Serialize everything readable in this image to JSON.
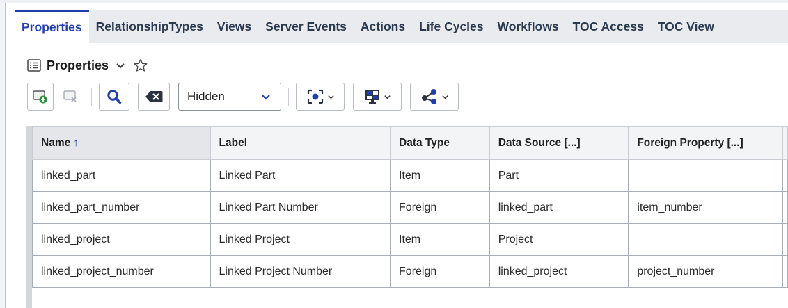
{
  "tabs": [
    {
      "label": "Properties",
      "active": true
    },
    {
      "label": "RelationshipTypes",
      "active": false
    },
    {
      "label": "Views",
      "active": false
    },
    {
      "label": "Server Events",
      "active": false
    },
    {
      "label": "Actions",
      "active": false
    },
    {
      "label": "Life Cycles",
      "active": false
    },
    {
      "label": "Workflows",
      "active": false
    },
    {
      "label": "TOC Access",
      "active": false
    },
    {
      "label": "TOC View",
      "active": false
    }
  ],
  "section": {
    "title": "Properties"
  },
  "toolbar": {
    "view_select_value": "Hidden"
  },
  "grid": {
    "columns": [
      "Name",
      "Label",
      "Data Type",
      "Data Source [...]",
      "Foreign Property [...]"
    ],
    "sort_indicator": "↑",
    "rows": [
      [
        "linked_part",
        "Linked Part",
        "Item",
        "Part",
        ""
      ],
      [
        "linked_part_number",
        "Linked Part Number",
        "Foreign",
        "linked_part",
        "item_number"
      ],
      [
        "linked_project",
        "Linked Project",
        "Item",
        "Project",
        ""
      ],
      [
        "linked_project_number",
        "Linked Project Number",
        "Foreign",
        "linked_project",
        "project_number"
      ]
    ]
  },
  "colors": {
    "accent": "#1f3fae",
    "tab_bar_bg": "#e9ebef",
    "add_icon_green": "#2e8b3e"
  }
}
